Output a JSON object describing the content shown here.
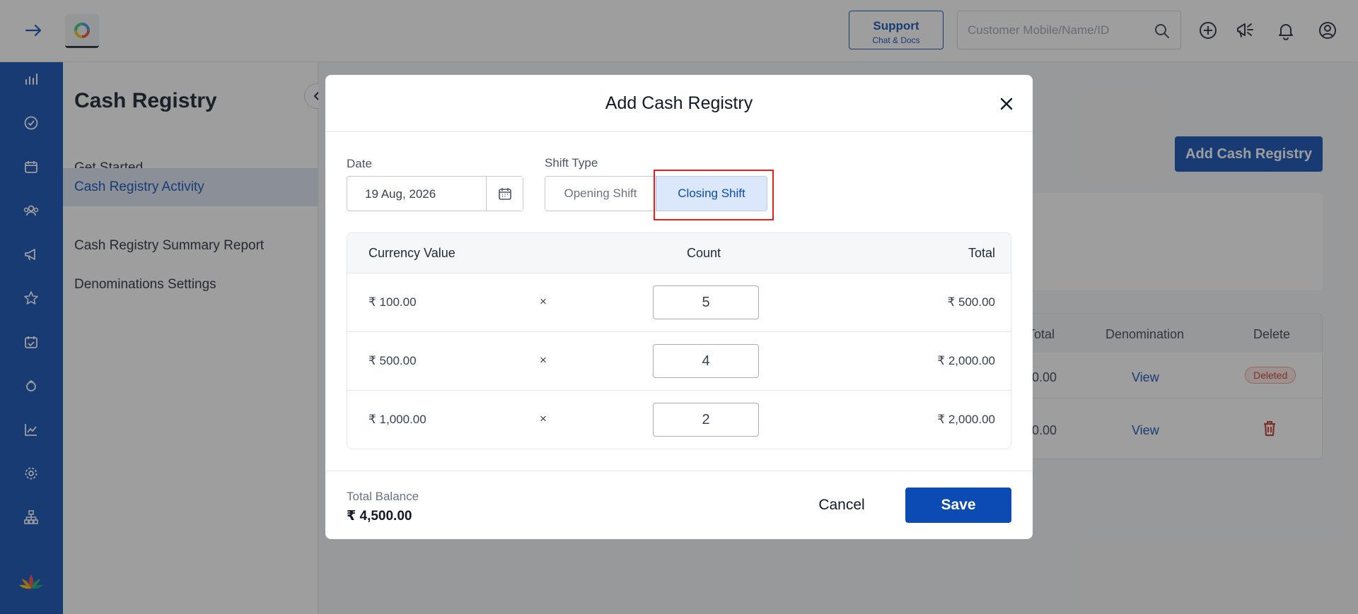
{
  "topbar": {
    "support_label": "Support",
    "support_sub": "Chat & Docs",
    "search_placeholder": "Customer Mobile/Name/ID"
  },
  "subnav": {
    "title": "Cash Registry",
    "items": [
      {
        "label": "Get Started",
        "active": false
      },
      {
        "label": "Cash Registry Activity",
        "active": true
      },
      {
        "label": "Cash Registry Summary Report",
        "active": false
      },
      {
        "label": "Denominations Settings",
        "active": false
      }
    ]
  },
  "background": {
    "add_button_label": "Add Cash Registry",
    "columns": [
      "Total",
      "Denomination",
      "Delete"
    ],
    "rows": [
      {
        "total_fragment": "0.00",
        "denomination": "View",
        "delete_status": "Deleted"
      },
      {
        "total_fragment": "0.00",
        "denomination": "View",
        "delete_status": "trash"
      }
    ]
  },
  "modal": {
    "title": "Add Cash Registry",
    "date_label": "Date",
    "date_value": "19 Aug, 2026",
    "shift_label": "Shift Type",
    "shift_options": [
      "Opening Shift",
      "Closing Shift"
    ],
    "selected_shift": "Closing Shift",
    "table": {
      "headers": {
        "currency": "Currency Value",
        "count": "Count",
        "total": "Total"
      },
      "rows": [
        {
          "currency": "₹ 100.00",
          "sign": "×",
          "count": "5",
          "total": "₹ 500.00"
        },
        {
          "currency": "₹ 500.00",
          "sign": "×",
          "count": "4",
          "total": "₹ 2,000.00"
        },
        {
          "currency": "₹ 1,000.00",
          "sign": "×",
          "count": "2",
          "total": "₹ 2,000.00"
        }
      ]
    },
    "total_balance_label": "Total Balance",
    "total_balance_value": "₹ 4,500.00",
    "cancel_label": "Cancel",
    "save_label": "Save"
  },
  "colors": {
    "primary": "#0b4bb3",
    "highlight": "#e0201c",
    "danger": "#c0392b"
  }
}
